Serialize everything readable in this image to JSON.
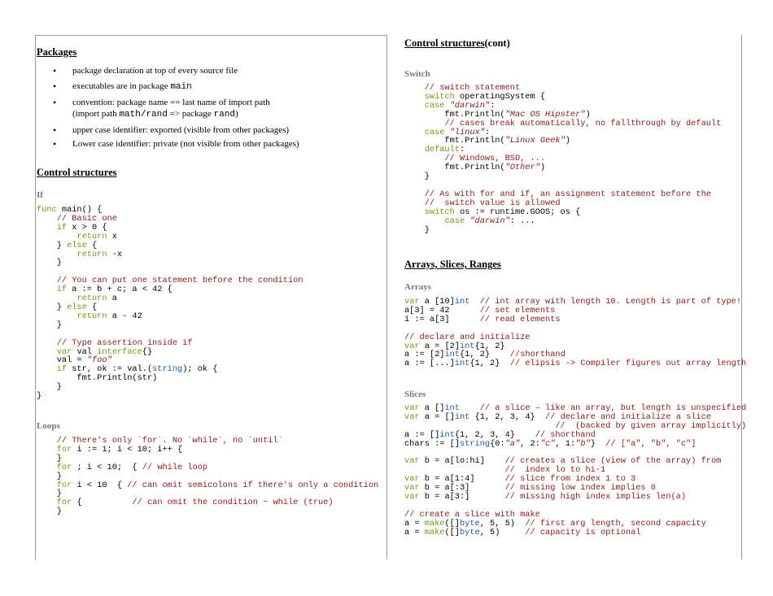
{
  "left": {
    "packages": {
      "heading": "Packages",
      "items": [
        {
          "text": "package declaration at top of every source file"
        },
        {
          "pre": "executables are in package ",
          "code": "main"
        },
        {
          "pre": "convention: package name == last name of import path",
          "line2_pre": "(import path ",
          "line2_code1": "math/rand",
          "line2_mid": " => package ",
          "line2_code2": "rand",
          "line2_post": ")"
        },
        {
          "text": "upper case identifier: exported (visible from other packages)"
        },
        {
          "text": "Lower case identifier: private (not visible from other packages)"
        }
      ]
    },
    "control": {
      "heading": "Control structures"
    },
    "if_block": {
      "heading": "If",
      "lines": [
        [
          {
            "t": "func",
            "c": "kw"
          },
          {
            "t": " main() {"
          }
        ],
        [
          {
            "t": "    "
          },
          {
            "t": "// Basic one",
            "c": "cm"
          }
        ],
        [
          {
            "t": "    "
          },
          {
            "t": "if",
            "c": "kw"
          },
          {
            "t": " x > 0 {"
          }
        ],
        [
          {
            "t": "        "
          },
          {
            "t": "return",
            "c": "kw"
          },
          {
            "t": " x"
          }
        ],
        [
          {
            "t": "    } "
          },
          {
            "t": "else",
            "c": "kw"
          },
          {
            "t": " {"
          }
        ],
        [
          {
            "t": "        "
          },
          {
            "t": "return",
            "c": "kw"
          },
          {
            "t": " -x"
          }
        ],
        [
          {
            "t": "    }"
          }
        ],
        [
          {
            "t": ""
          }
        ],
        [
          {
            "t": "    "
          },
          {
            "t": "// You can put one statement before the condition",
            "c": "cm"
          }
        ],
        [
          {
            "t": "    "
          },
          {
            "t": "if",
            "c": "kw"
          },
          {
            "t": " a := b + c; a < 42 {"
          }
        ],
        [
          {
            "t": "        "
          },
          {
            "t": "return",
            "c": "kw"
          },
          {
            "t": " a"
          }
        ],
        [
          {
            "t": "    } "
          },
          {
            "t": "else",
            "c": "kw"
          },
          {
            "t": " {"
          }
        ],
        [
          {
            "t": "        "
          },
          {
            "t": "return",
            "c": "kw"
          },
          {
            "t": " a - 42"
          }
        ],
        [
          {
            "t": "    }"
          }
        ],
        [
          {
            "t": ""
          }
        ],
        [
          {
            "t": "    "
          },
          {
            "t": "// Type assertion inside if",
            "c": "cm"
          }
        ],
        [
          {
            "t": "    "
          },
          {
            "t": "var",
            "c": "kw"
          },
          {
            "t": " val "
          },
          {
            "t": "interface",
            "c": "kw"
          },
          {
            "t": "{}"
          }
        ],
        [
          {
            "t": "    val = "
          },
          {
            "t": "\"foo\"",
            "c": "st"
          }
        ],
        [
          {
            "t": "    "
          },
          {
            "t": "if",
            "c": "kw"
          },
          {
            "t": " str, ok := val.("
          },
          {
            "t": "string",
            "c": "ty"
          },
          {
            "t": "); ok {"
          }
        ],
        [
          {
            "t": "        fmt.Println(str)"
          }
        ],
        [
          {
            "t": "    }"
          }
        ],
        [
          {
            "t": "}"
          }
        ]
      ]
    },
    "loops": {
      "heading": "Loops",
      "lines": [
        [
          {
            "t": "    "
          },
          {
            "t": "// There's only `for`. No `while`, no `until`",
            "c": "cm"
          }
        ],
        [
          {
            "t": "    "
          },
          {
            "t": "for",
            "c": "kw"
          },
          {
            "t": " i := 1; i < 10; i++ {"
          }
        ],
        [
          {
            "t": "    }"
          }
        ],
        [
          {
            "t": "    "
          },
          {
            "t": "for",
            "c": "kw"
          },
          {
            "t": " ; i < 10;  { "
          },
          {
            "t": "// while loop",
            "c": "cm"
          }
        ],
        [
          {
            "t": "    }"
          }
        ],
        [
          {
            "t": "    "
          },
          {
            "t": "for",
            "c": "kw"
          },
          {
            "t": " i < 10  { "
          },
          {
            "t": "// can omit semicolons if there's only a condition",
            "c": "cm"
          }
        ],
        [
          {
            "t": "    }"
          }
        ],
        [
          {
            "t": "    "
          },
          {
            "t": "for",
            "c": "kw"
          },
          {
            "t": " {          "
          },
          {
            "t": "// can omit the condition ~ while (true)",
            "c": "cm"
          }
        ],
        [
          {
            "t": "    }"
          }
        ]
      ]
    }
  },
  "right": {
    "control_cont": {
      "heading": "Control structures",
      "suffix": " (cont)"
    },
    "switch": {
      "heading": "Switch",
      "lines": [
        [
          {
            "t": "    "
          },
          {
            "t": "// switch statement",
            "c": "cm"
          }
        ],
        [
          {
            "t": "    "
          },
          {
            "t": "switch",
            "c": "kw"
          },
          {
            "t": " operatingSystem {"
          }
        ],
        [
          {
            "t": "    "
          },
          {
            "t": "case",
            "c": "kw"
          },
          {
            "t": " "
          },
          {
            "t": "\"darwin\"",
            "c": "st"
          },
          {
            "t": ":"
          }
        ],
        [
          {
            "t": "        fmt.Println("
          },
          {
            "t": "\"Mac OS Hipster\"",
            "c": "st"
          },
          {
            "t": ")"
          }
        ],
        [
          {
            "t": "        "
          },
          {
            "t": "// cases break automatically, no fallthrough by default",
            "c": "cm"
          }
        ],
        [
          {
            "t": "    "
          },
          {
            "t": "case",
            "c": "kw"
          },
          {
            "t": " "
          },
          {
            "t": "\"linux\"",
            "c": "st"
          },
          {
            "t": ":"
          }
        ],
        [
          {
            "t": "        fmt.Println("
          },
          {
            "t": "\"Linux Geek\"",
            "c": "st"
          },
          {
            "t": ")"
          }
        ],
        [
          {
            "t": "    "
          },
          {
            "t": "default",
            "c": "kw"
          },
          {
            "t": ":"
          }
        ],
        [
          {
            "t": "        "
          },
          {
            "t": "// Windows, BSD, ...",
            "c": "cm"
          }
        ],
        [
          {
            "t": "        fmt.Println("
          },
          {
            "t": "\"Other\"",
            "c": "st"
          },
          {
            "t": ")"
          }
        ],
        [
          {
            "t": "    }"
          }
        ],
        [
          {
            "t": ""
          }
        ],
        [
          {
            "t": "    "
          },
          {
            "t": "// As with for and if, an assignment statement before the",
            "c": "cm"
          }
        ],
        [
          {
            "t": "    "
          },
          {
            "t": "//  switch value is allowed",
            "c": "cm"
          }
        ],
        [
          {
            "t": "    "
          },
          {
            "t": "switch",
            "c": "kw"
          },
          {
            "t": " os := runtime.GOOS; os {"
          }
        ],
        [
          {
            "t": "        "
          },
          {
            "t": "case",
            "c": "kw"
          },
          {
            "t": " "
          },
          {
            "t": "\"darwin\"",
            "c": "st"
          },
          {
            "t": ": ..."
          }
        ],
        [
          {
            "t": "    }"
          }
        ]
      ]
    },
    "arrays_section": {
      "heading": "Arrays, Slices, Ranges"
    },
    "arrays": {
      "heading": "Arrays",
      "lines": [
        [
          {
            "t": "var",
            "c": "kw"
          },
          {
            "t": " a [10]"
          },
          {
            "t": "int",
            "c": "ty"
          },
          {
            "t": "  "
          },
          {
            "t": "// int array with length 10. Length is part of type!",
            "c": "cm"
          }
        ],
        [
          {
            "t": "a[3] = 42      "
          },
          {
            "t": "// set elements",
            "c": "cm"
          }
        ],
        [
          {
            "t": "i := a[3]      "
          },
          {
            "t": "// read elements",
            "c": "cm"
          }
        ],
        [
          {
            "t": ""
          }
        ],
        [
          {
            "t": "// declare and initialize",
            "c": "cm"
          }
        ],
        [
          {
            "t": "var",
            "c": "kw"
          },
          {
            "t": " a = [2]"
          },
          {
            "t": "int",
            "c": "ty"
          },
          {
            "t": "{1, 2}"
          }
        ],
        [
          {
            "t": "a := [2]"
          },
          {
            "t": "int",
            "c": "ty"
          },
          {
            "t": "{1, 2}    "
          },
          {
            "t": "//shorthand",
            "c": "cm"
          }
        ],
        [
          {
            "t": "a := [...]"
          },
          {
            "t": "int",
            "c": "ty"
          },
          {
            "t": "{1, 2}  "
          },
          {
            "t": "// elipsis -> Compiler figures out array length",
            "c": "cm"
          }
        ]
      ]
    },
    "slices": {
      "heading": "Slices",
      "lines": [
        [
          {
            "t": "var",
            "c": "kw"
          },
          {
            "t": " a []"
          },
          {
            "t": "int",
            "c": "ty"
          },
          {
            "t": "    "
          },
          {
            "t": "// a slice – like an array, but length is unspecified",
            "c": "cm"
          }
        ],
        [
          {
            "t": "var",
            "c": "kw"
          },
          {
            "t": " a = []"
          },
          {
            "t": "int",
            "c": "ty"
          },
          {
            "t": " {1, 2, 3, 4}  "
          },
          {
            "t": "// declare and initialize a slice",
            "c": "cm"
          }
        ],
        [
          {
            "t": "                              "
          },
          {
            "t": "//  (backed by given array implicitly)",
            "c": "cm"
          }
        ],
        [
          {
            "t": "a := []"
          },
          {
            "t": "int",
            "c": "ty"
          },
          {
            "t": "{1, 2, 3, 4}    "
          },
          {
            "t": "// shorthand",
            "c": "cm"
          }
        ],
        [
          {
            "t": "chars := []"
          },
          {
            "t": "string",
            "c": "ty"
          },
          {
            "t": "{0:"
          },
          {
            "t": "\"a\"",
            "c": "st"
          },
          {
            "t": ", 2:"
          },
          {
            "t": "\"c\"",
            "c": "st"
          },
          {
            "t": ", 1:"
          },
          {
            "t": "\"b\"",
            "c": "st"
          },
          {
            "t": "}  "
          },
          {
            "t": "// [\"a\", \"b\", \"c\"]",
            "c": "cm"
          }
        ],
        [
          {
            "t": ""
          }
        ],
        [
          {
            "t": "var",
            "c": "kw"
          },
          {
            "t": " b = a[lo:hi]    "
          },
          {
            "t": "// creates a slice (view of the array) from",
            "c": "cm"
          }
        ],
        [
          {
            "t": "                    "
          },
          {
            "t": "//  index lo to hi-1",
            "c": "cm"
          }
        ],
        [
          {
            "t": "var",
            "c": "kw"
          },
          {
            "t": " b = a[1:4]      "
          },
          {
            "t": "// slice from index 1 to 3",
            "c": "cm"
          }
        ],
        [
          {
            "t": "var",
            "c": "kw"
          },
          {
            "t": " b = a[:3]       "
          },
          {
            "t": "// missing low index implies 0",
            "c": "cm"
          }
        ],
        [
          {
            "t": "var",
            "c": "kw"
          },
          {
            "t": " b = a[3:]       "
          },
          {
            "t": "// missing high index implies len(a)",
            "c": "cm"
          }
        ],
        [
          {
            "t": ""
          }
        ],
        [
          {
            "t": "// create a slice with make",
            "c": "cm"
          }
        ],
        [
          {
            "t": "a = "
          },
          {
            "t": "make",
            "c": "kw"
          },
          {
            "t": "([]"
          },
          {
            "t": "byte",
            "c": "ty"
          },
          {
            "t": ", 5, 5)  "
          },
          {
            "t": "// first arg length, second capacity",
            "c": "cm"
          }
        ],
        [
          {
            "t": "a = "
          },
          {
            "t": "make",
            "c": "kw"
          },
          {
            "t": "([]"
          },
          {
            "t": "byte",
            "c": "ty"
          },
          {
            "t": ", 5)     "
          },
          {
            "t": "// capacity is optional",
            "c": "cm"
          }
        ]
      ]
    }
  }
}
